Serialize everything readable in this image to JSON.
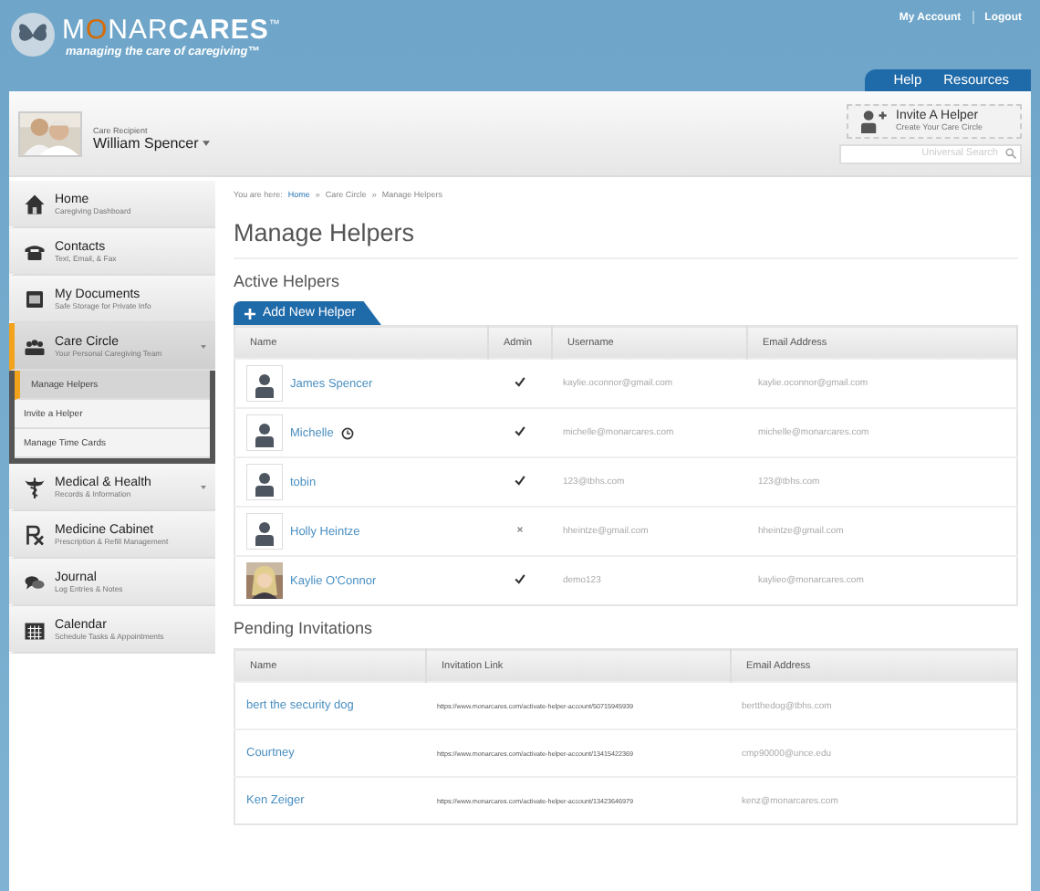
{
  "header": {
    "logo": {
      "brand_part1": "M",
      "brand_accent": "O",
      "brand_part2": "NAR",
      "brand_bold": "CARES",
      "trademark": "™",
      "tagline": "managing the care of caregiving™"
    },
    "links": [
      "My Account",
      "Logout"
    ],
    "tabs": [
      {
        "label": "Help",
        "selected": false
      },
      {
        "label": "Resources",
        "selected": false
      }
    ]
  },
  "recipient": {
    "caption": "Care Recipient",
    "name": "William Spencer"
  },
  "invite": {
    "title": "Invite A Helper",
    "subtitle": "Create Your Care Circle"
  },
  "search": {
    "placeholder": "Universal Search"
  },
  "sidebar": {
    "items": [
      {
        "kind": "home",
        "title": "Home",
        "subtitle": "Caregiving Dashboard",
        "selected": false,
        "expandable": false
      },
      {
        "kind": "phone",
        "title": "Contacts",
        "subtitle": "Text, Email, & Fax",
        "selected": false,
        "expandable": false
      },
      {
        "kind": "document",
        "title": "My Documents",
        "subtitle": "Safe Storage for Private Info",
        "selected": false,
        "expandable": false
      },
      {
        "kind": "group",
        "title": "Care Circle",
        "subtitle": "Your Personal Caregiving Team",
        "selected": true,
        "expandable": true,
        "children": [
          {
            "label": "Manage Helpers",
            "selected": true
          },
          {
            "label": "Invite a Helper",
            "selected": false
          },
          {
            "label": "Manage Time Cards",
            "selected": false
          }
        ]
      },
      {
        "kind": "caduceus",
        "title": "Medical & Health",
        "subtitle": "Records & Information",
        "selected": false,
        "expandable": true
      },
      {
        "kind": "rx",
        "title": "Medicine Cabinet",
        "subtitle": "Prescription & Refill Management",
        "selected": false,
        "expandable": false
      },
      {
        "kind": "chat",
        "title": "Journal",
        "subtitle": "Log Entries & Notes",
        "selected": false,
        "expandable": false
      },
      {
        "kind": "calendar",
        "title": "Calendar",
        "subtitle": "Schedule Tasks & Appointments",
        "selected": false,
        "expandable": false
      }
    ]
  },
  "breadcrumb": {
    "prefix": "You are here:",
    "items": [
      {
        "label": "Home",
        "link": true
      },
      {
        "label": "Care Circle",
        "link": false
      },
      {
        "label": "Manage Helpers",
        "link": false
      }
    ],
    "separator": "»"
  },
  "page_title": "Manage Helpers",
  "active_helpers": {
    "heading": "Active Helpers",
    "add_button": "Add New Helper",
    "columns": [
      "Name",
      "Admin",
      "Username",
      "Email Address"
    ],
    "rows": [
      {
        "name": "James Spencer",
        "photo": false,
        "timecard": false,
        "admin": true,
        "username": "kaylie.oconnor@gmail.com",
        "email": "kaylie.oconnor@gmail.com"
      },
      {
        "name": "Michelle",
        "photo": false,
        "timecard": true,
        "admin": true,
        "username": "michelle@monarcares.com",
        "email": "michelle@monarcares.com"
      },
      {
        "name": "tobin",
        "photo": false,
        "timecard": false,
        "admin": true,
        "username": "123@tbhs.com",
        "email": "123@tbhs.com"
      },
      {
        "name": "Holly Heintze",
        "photo": false,
        "timecard": false,
        "admin": false,
        "username": "hheintze@gmail.com",
        "email": "hheintze@gmail.com"
      },
      {
        "name": "Kaylie O'Connor",
        "photo": true,
        "timecard": false,
        "admin": true,
        "username": "demo123",
        "email": "kaylieo@monarcares.com"
      }
    ]
  },
  "pending_invitations": {
    "heading": "Pending Invitations",
    "columns": [
      "Name",
      "Invitation Link",
      "Email Address"
    ],
    "rows": [
      {
        "name": "bert the security dog",
        "link": "https://www.monarcares.com/activate-helper-account/50715945939",
        "email": "bertthedog@tbhs.com"
      },
      {
        "name": "Courtney",
        "link": "https://www.monarcares.com/activate-helper-account/13415422369",
        "email": "cmp90000@unce.edu"
      },
      {
        "name": "Ken Zeiger",
        "link": "https://www.monarcares.com/activate-helper-account/13423646979",
        "email": "kenz@monarcares.com"
      }
    ]
  }
}
